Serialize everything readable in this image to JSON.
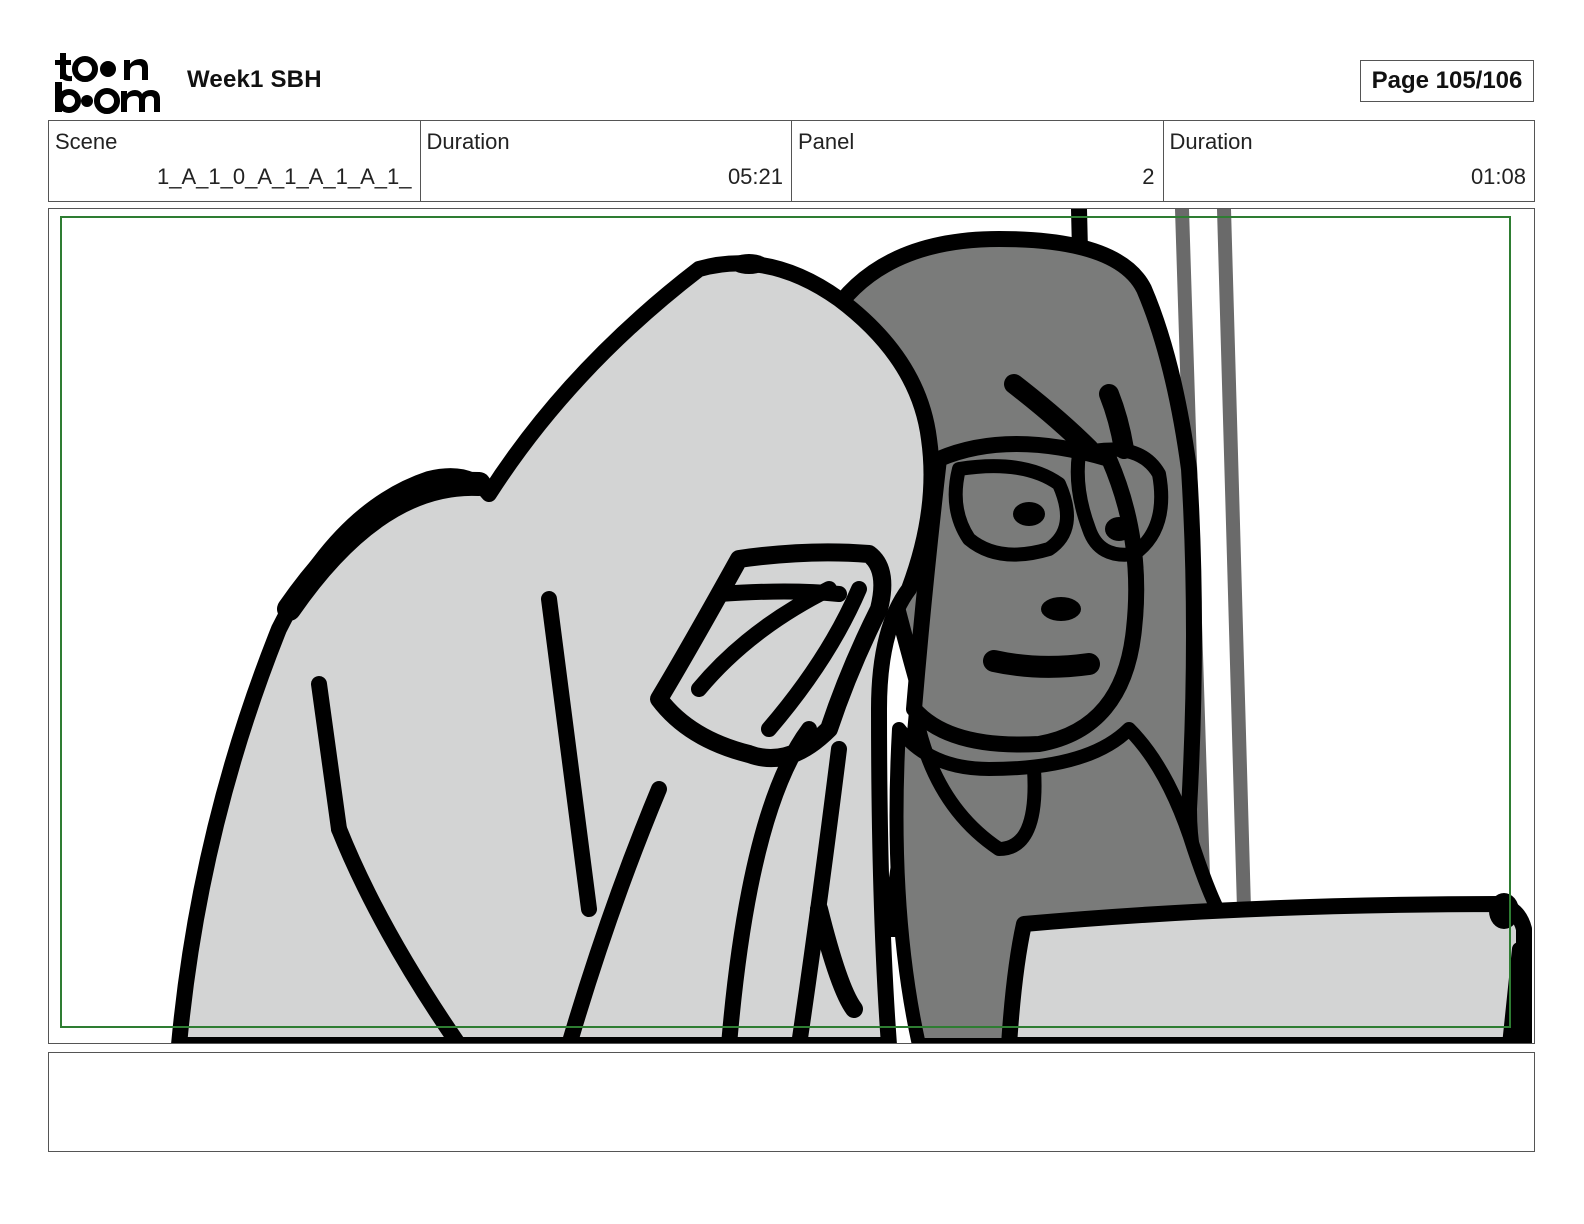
{
  "header": {
    "logo_text": "toon boom",
    "title": "Week1 SBH",
    "page": "Page 105/106"
  },
  "info": {
    "scene_label": "Scene",
    "scene_value": "1_A_1_0_A_1_A_1_A_1_",
    "scene_duration_label": "Duration",
    "scene_duration_value": "05:21",
    "panel_label": "Panel",
    "panel_value": "2",
    "panel_duration_label": "Duration",
    "panel_duration_value": "01:08"
  },
  "notes": {
    "text": ""
  },
  "colors": {
    "safe_frame": "#2e7d32",
    "light_fill": "#d3d4d4",
    "dark_fill": "#7a7b7a",
    "line": "#000000"
  }
}
